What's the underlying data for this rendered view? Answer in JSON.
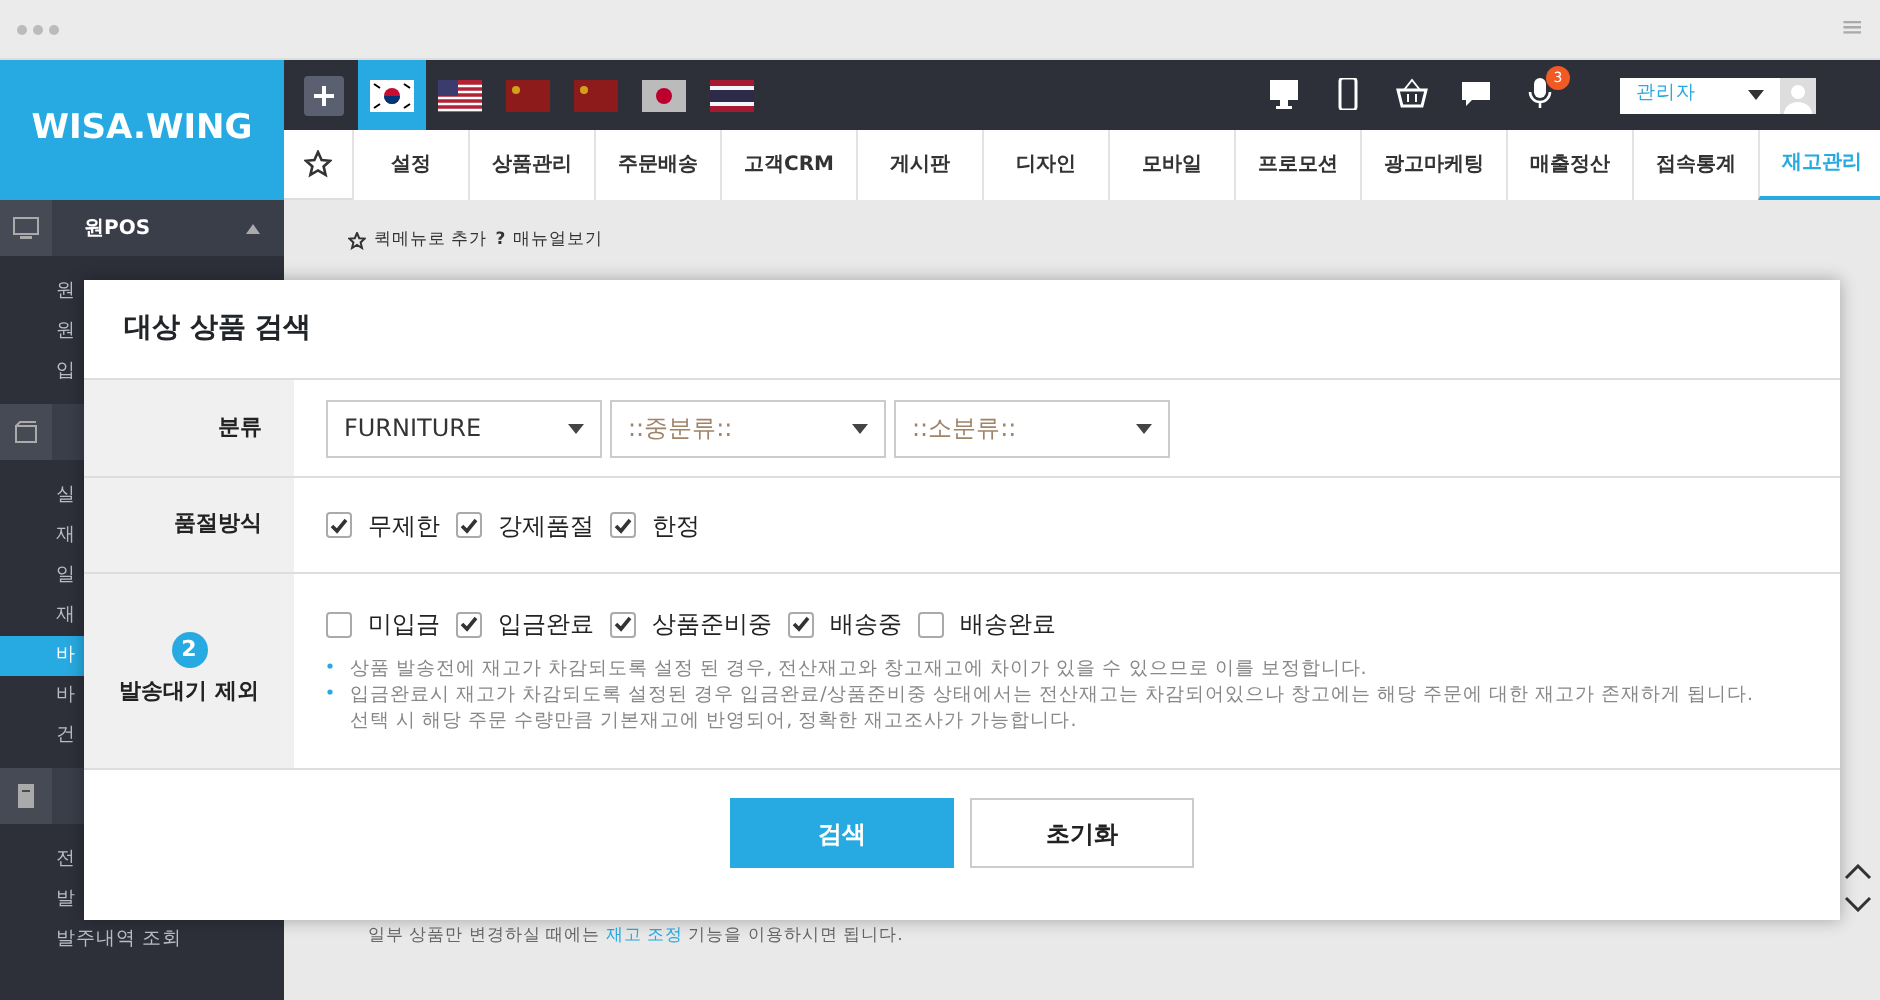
{
  "browser": {
    "menu_glyph": "≡"
  },
  "logo": "WISA.WING",
  "languages": [
    {
      "kind": "plus",
      "selected": false
    },
    {
      "kind": "kr",
      "selected": true
    },
    {
      "kind": "us",
      "selected": false
    },
    {
      "kind": "cn",
      "selected": false
    },
    {
      "kind": "cn",
      "selected": false
    },
    {
      "kind": "jp",
      "selected": false
    },
    {
      "kind": "th",
      "selected": false
    }
  ],
  "top_icons": [
    {
      "kind": "monitor"
    },
    {
      "kind": "phone"
    },
    {
      "kind": "basket"
    },
    {
      "kind": "chat"
    },
    {
      "kind": "mic",
      "badge": "3"
    }
  ],
  "user_select": {
    "value": "관리자"
  },
  "nav_tabs": [
    {
      "label": "설정",
      "selected": false
    },
    {
      "label": "상품관리",
      "selected": false
    },
    {
      "label": "주문배송",
      "selected": false
    },
    {
      "label": "고객CRM",
      "selected": false
    },
    {
      "label": "게시판",
      "selected": false
    },
    {
      "label": "디자인",
      "selected": false
    },
    {
      "label": "모바일",
      "selected": false
    },
    {
      "label": "프로모션",
      "selected": false
    },
    {
      "label": "광고마케팅",
      "selected": false
    },
    {
      "label": "매출정산",
      "selected": false
    },
    {
      "label": "접속통계",
      "selected": false
    },
    {
      "label": "재고관리",
      "selected": true
    }
  ],
  "sidebar": [
    {
      "title": "원POS",
      "items": [
        {
          "label": "원",
          "selected": false
        },
        {
          "label": "원",
          "selected": false
        },
        {
          "label": "입",
          "selected": false
        }
      ]
    },
    {
      "items": [
        {
          "label": "실",
          "selected": false
        },
        {
          "label": "재",
          "selected": false
        },
        {
          "label": "일",
          "selected": false
        },
        {
          "label": "재",
          "selected": false
        },
        {
          "label": "바",
          "selected": true
        },
        {
          "label": "바",
          "selected": false
        },
        {
          "label": "건",
          "selected": false
        }
      ]
    },
    {
      "items": [
        {
          "label": "전",
          "selected": false
        },
        {
          "label": "발",
          "selected": false
        },
        {
          "label": "발주내역 조회",
          "selected": false
        }
      ]
    }
  ],
  "breadcrumb": {
    "quick_add": "퀵메뉴로 추가",
    "help_glyph": "?",
    "manual": "매뉴얼보기"
  },
  "notice": {
    "before": "일부 상품만 변경하실 때에는",
    "link": "재고 조정",
    "after": "기능을 이용하시면 됩니다."
  },
  "modal": {
    "title": "대상 상품 검색",
    "category": {
      "label": "분류",
      "selects": [
        "FURNITURE",
        "::중분류::",
        "::소분류::"
      ]
    },
    "soldout": {
      "label": "품절방식",
      "options": [
        {
          "label": "무제한",
          "checked": true
        },
        {
          "label": "강제품절",
          "checked": true
        },
        {
          "label": "한정",
          "checked": true
        }
      ]
    },
    "exclude": {
      "badge": "2",
      "label": "발송대기 제외",
      "options": [
        {
          "label": "미입금",
          "checked": false
        },
        {
          "label": "입금완료",
          "checked": true
        },
        {
          "label": "상품준비중",
          "checked": true
        },
        {
          "label": "배송중",
          "checked": true
        },
        {
          "label": "배송완료",
          "checked": false
        }
      ],
      "notes": [
        [
          "상품 발송전에 재고가 차감되도록 설정 된 경우, 전산재고와 창고재고에 차이가 있을 수 있으므로 이를 보정합니다."
        ],
        [
          "입금완료시 재고가 차감되도록 설정된 경우 입금완료/상품준비중 상태에서는 전산재고는 차감되어있으나 창고에는 해당 주문에 대한 재고가 존재하게 됩니다.",
          "선택 시 해당 주문 수량만큼 기본재고에 반영되어, 정확한 재고조사가 가능합니다."
        ]
      ]
    },
    "buttons": [
      {
        "label": "검색",
        "kind": "primary"
      },
      {
        "label": "초기화",
        "kind": "secondary"
      }
    ]
  }
}
